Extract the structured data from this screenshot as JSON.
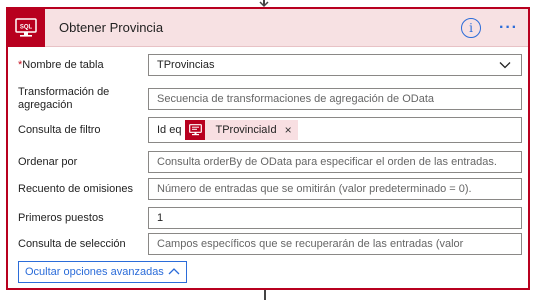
{
  "card": {
    "title": "Obtener Provincia",
    "icon_label": "SQL",
    "accent_color": "#b8001f",
    "header_bg": "#f7e1e3"
  },
  "fields": {
    "table_name": {
      "label": "Nombre de tabla",
      "required_mark": "*",
      "value": "TProvincias"
    },
    "transformation": {
      "label": "Transformación de agregación",
      "placeholder": "Secuencia de transformaciones de agregación de OData"
    },
    "filter": {
      "label": "Consulta de filtro",
      "prefix": "Id eq",
      "token": "TProvinciaId",
      "token_remove": "×"
    },
    "order_by": {
      "label": "Ordenar por",
      "placeholder": "Consulta orderBy de OData para especificar el orden de las entradas."
    },
    "skip": {
      "label": "Recuento de omisiones",
      "placeholder": "Número de entradas que se omitirán (valor predeterminado = 0)."
    },
    "top": {
      "label": "Primeros puestos",
      "value": "1"
    },
    "select": {
      "label": "Consulta de selección",
      "placeholder": "Campos específicos que se recuperarán de las entradas (valor"
    }
  },
  "advanced_toggle": {
    "label": "Ocultar opciones avanzadas"
  },
  "icons": [
    "sql-database-icon",
    "info-icon",
    "more-options-icon",
    "chevron-down-icon",
    "chevron-up-icon"
  ]
}
